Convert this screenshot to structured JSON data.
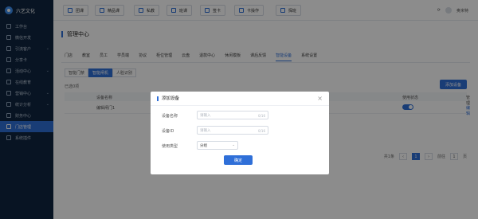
{
  "brand": {
    "name": "六艺文化"
  },
  "sidebar": {
    "items": [
      {
        "label": "工作台",
        "icon": "home-icon",
        "chevron": false,
        "active": false
      },
      {
        "label": "微信开发",
        "icon": "wechat-icon",
        "chevron": false,
        "active": false
      },
      {
        "label": "引流客户",
        "icon": "users-icon",
        "chevron": true,
        "active": false
      },
      {
        "label": "分享卡",
        "icon": "card-icon",
        "chevron": false,
        "active": false
      },
      {
        "label": "活动中心",
        "icon": "activity-icon",
        "chevron": true,
        "active": false
      },
      {
        "label": "在线教育",
        "icon": "education-icon",
        "chevron": false,
        "active": false
      },
      {
        "label": "营销中心",
        "icon": "marketing-icon",
        "chevron": true,
        "active": false
      },
      {
        "label": "统计分析",
        "icon": "chart-icon",
        "chevron": true,
        "active": false
      },
      {
        "label": "财务中心",
        "icon": "finance-icon",
        "chevron": false,
        "active": false
      },
      {
        "label": "门店管理",
        "icon": "store-icon",
        "chevron": false,
        "active": true
      },
      {
        "label": "系统插件",
        "icon": "plugin-icon",
        "chevron": false,
        "active": false
      }
    ]
  },
  "topbar": {
    "buttons": [
      "团课",
      "精品课",
      "私教",
      "班课",
      "签卡",
      "卡操作",
      "探班"
    ],
    "user": "奥米特"
  },
  "page": {
    "title": "管理中心",
    "tabs": [
      "门店",
      "教室",
      "员工",
      "学员端",
      "协议",
      "柜位管理",
      "云盘",
      "退款中心",
      "休闲模板",
      "课后反馈",
      "智能设备",
      "系统设置"
    ],
    "active_tab": 10,
    "subtabs": [
      "智能门禁",
      "智能闸机",
      "人脸识别"
    ],
    "active_subtab": 1,
    "selected_count": "已选0项",
    "add_button": "添加设备"
  },
  "table": {
    "headers": [
      "设备名称",
      "使用状态",
      "管理"
    ],
    "rows": [
      {
        "name": "编辑闸门1",
        "link": "编辑"
      }
    ],
    "toggle_on": true
  },
  "pager": {
    "total": "共1条",
    "current": "1",
    "goto_label": "前往",
    "page_label": "页"
  },
  "modal": {
    "title": "添加设备",
    "close": "×",
    "fields": [
      {
        "label": "设备名称",
        "placeholder": "请输入",
        "counter": "0/16"
      },
      {
        "label": "设备ID",
        "placeholder": "请输入",
        "counter": "0/16"
      }
    ],
    "type_label": "使用类型",
    "type_value": "分组",
    "confirm": "确定"
  },
  "colors": {
    "accent": "#2f6fd8",
    "sidebar": "#0f2540",
    "overlay": "rgba(0,0,0,0.45)"
  }
}
